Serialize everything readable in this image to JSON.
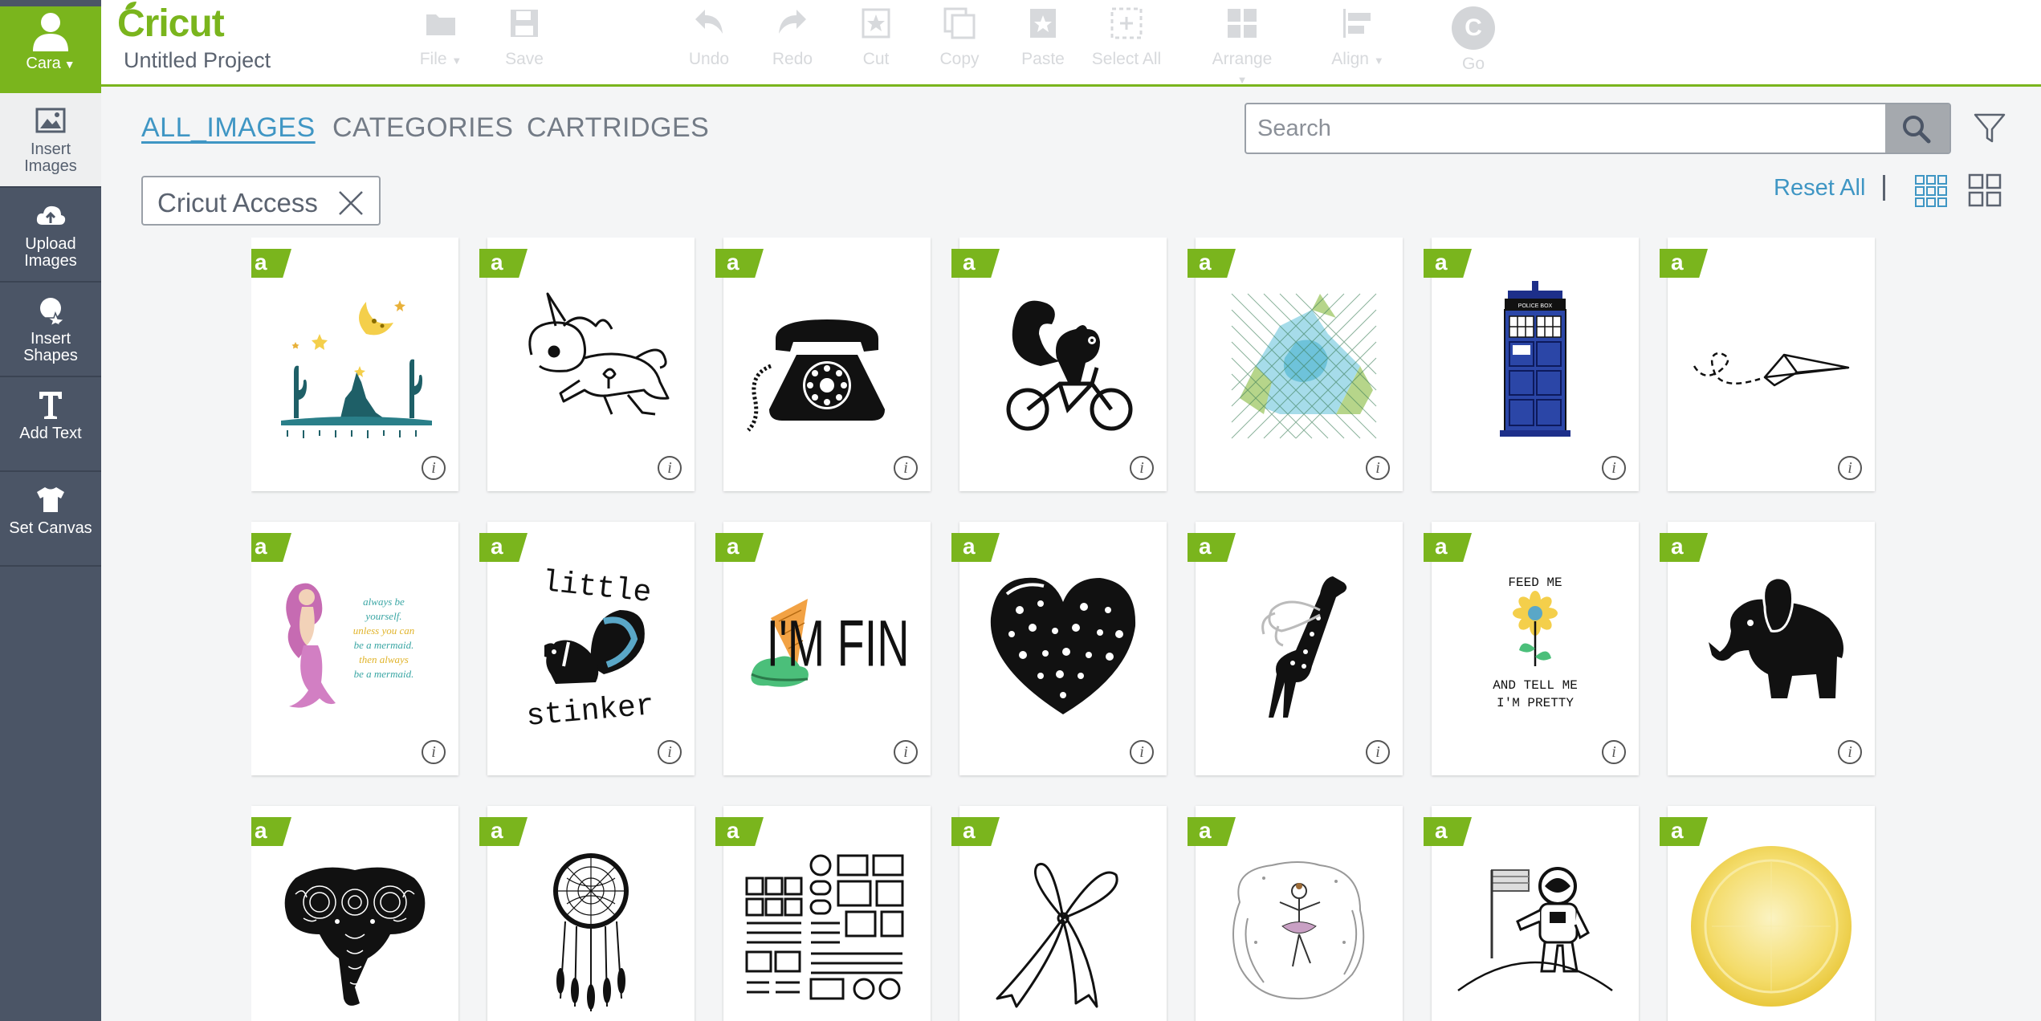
{
  "user": {
    "name": "Cara"
  },
  "sidebar": {
    "items": [
      {
        "label": "Insert\nImages",
        "icon": "image-icon"
      },
      {
        "label": "Upload\nImages",
        "icon": "cloud-upload-icon"
      },
      {
        "label": "Insert\nShapes",
        "icon": "shapes-icon"
      },
      {
        "label": "Add Text",
        "icon": "text-icon"
      },
      {
        "label": "Set Canvas",
        "icon": "tshirt-icon"
      }
    ]
  },
  "topbar": {
    "logo": "Cricut",
    "project_title": "Untitled Project",
    "tools": {
      "file": "File",
      "save": "Save",
      "undo": "Undo",
      "redo": "Redo",
      "cut": "Cut",
      "copy": "Copy",
      "paste": "Paste",
      "select_all": "Select All",
      "arrange": "Arrange",
      "align": "Align",
      "go": "Go",
      "go_letter": "C"
    }
  },
  "tabs": {
    "all_images": "ALL_IMAGES",
    "categories": "CATEGORIES",
    "cartridges": "CARTRIDGES"
  },
  "search": {
    "placeholder": "Search",
    "value": ""
  },
  "filter_chip": {
    "label": "Cricut Access"
  },
  "reset_all": "Reset All",
  "badge_letter": "a",
  "info_glyph": "i",
  "text_art": {
    "mermaid": [
      "always be",
      "yourself.",
      "unless you can",
      "be a mermaid.",
      "then always",
      "be a mermaid."
    ],
    "skunk_top": "little",
    "skunk_bottom": "stinker",
    "fine": "I'M FINE",
    "flower_top": "FEED ME",
    "flower_bottom_1": "AND TELL ME",
    "flower_bottom_2": "I'M PRETTY",
    "tardis": "POLICE BOX"
  },
  "colors": {
    "accent_green": "#7ab51d",
    "link_blue": "#3f96c4",
    "sidebar": "#4b5566"
  }
}
